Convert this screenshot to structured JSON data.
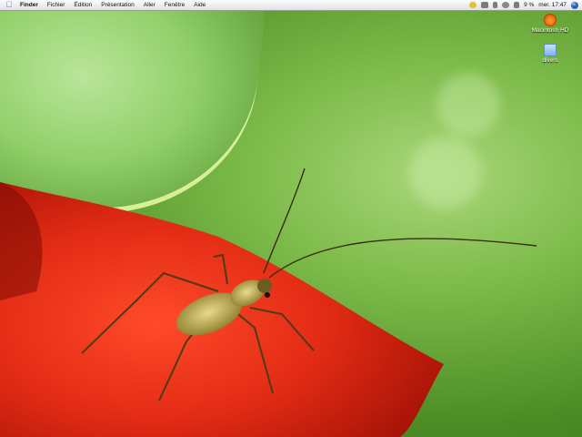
{
  "menubar": {
    "apple_icon": "apple-logo-icon",
    "app_name": "Finder",
    "menus": [
      "Fichier",
      "Édition",
      "Présentation",
      "Aller",
      "Fenêtre",
      "Aide"
    ],
    "status_icons": [
      "script-icon",
      "display-icon",
      "phone-icon",
      "wifi-icon",
      "volume-icon"
    ],
    "battery_text": "9 %",
    "clock": "mer. 17:47",
    "spotlight_icon": "spotlight-icon"
  },
  "desktop": {
    "icons": [
      {
        "label": "Macintosh HD",
        "icon": "hard-drive-icon"
      },
      {
        "label": "divers",
        "icon": "folder-icon"
      }
    ]
  }
}
